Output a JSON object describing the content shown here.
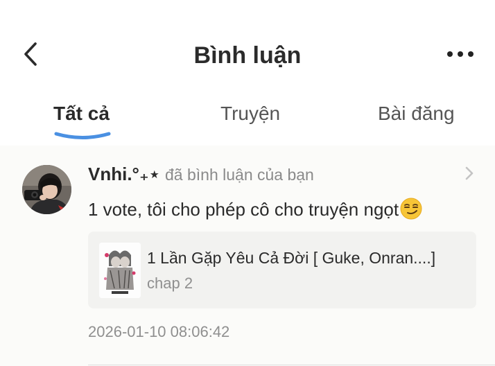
{
  "header": {
    "title": "Bình luận",
    "back_icon": "chevron-left-icon",
    "more_icon": "more-horizontal-icon"
  },
  "tabs": [
    {
      "label": "Tất cả",
      "active": true
    },
    {
      "label": "Truyện",
      "active": false
    },
    {
      "label": "Bài đăng",
      "active": false
    }
  ],
  "colors": {
    "tab_indicator": "#4a90e2",
    "content_background": "#fbfbf9",
    "card_background": "#f2f2f0",
    "muted_text": "#8f8f8f"
  },
  "notification": {
    "username": "Vnhi.°₊⋆",
    "action": "đã bình luận của bạn",
    "comment": "1 vote, tôi cho phép cô cho truyện ngọt",
    "comment_emoji": "smirking-face-emoji",
    "story": {
      "title": "1 Lần Gặp Yêu Cả Đời [ Guke, Onran....]",
      "chapter": "chap 2"
    },
    "timestamp": "2026-01-10 08:06:42"
  }
}
